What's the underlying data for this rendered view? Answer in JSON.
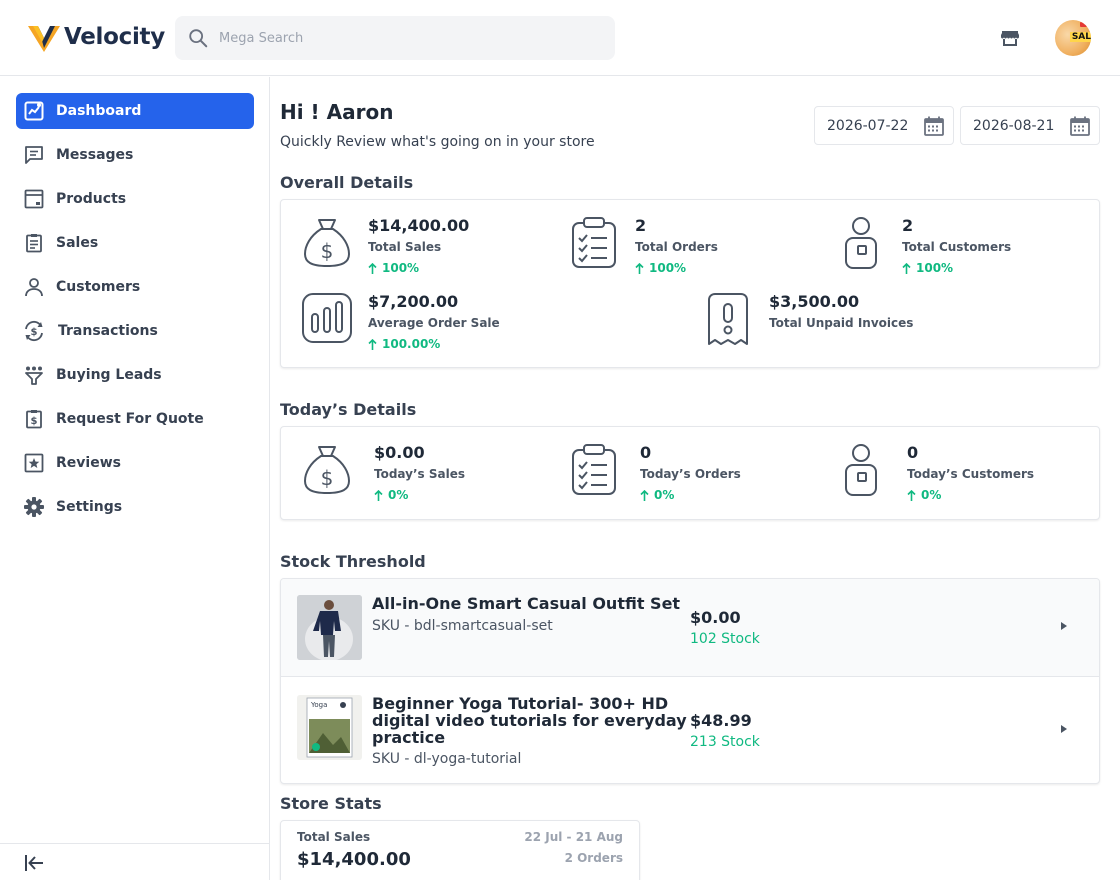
{
  "header": {
    "brand": "Velocity",
    "search_placeholder": "Mega Search",
    "avatar_badge": "SAL"
  },
  "sidebar": {
    "items": [
      {
        "label": "Dashboard",
        "icon": "dashboard-icon",
        "active": true
      },
      {
        "label": "Messages",
        "icon": "message-icon"
      },
      {
        "label": "Products",
        "icon": "product-icon"
      },
      {
        "label": "Sales",
        "icon": "sales-icon"
      },
      {
        "label": "Customers",
        "icon": "customer-icon"
      },
      {
        "label": "Transactions",
        "icon": "transaction-icon"
      },
      {
        "label": "Buying Leads",
        "icon": "funnel-icon"
      },
      {
        "label": "Request For Quote",
        "icon": "quote-icon"
      },
      {
        "label": "Reviews",
        "icon": "review-icon"
      },
      {
        "label": "Settings",
        "icon": "gear-icon"
      }
    ]
  },
  "main": {
    "greeting": "Hi ! Aaron",
    "subtitle": "Quickly Review what's going on in your store",
    "date_from": "2026-07-22",
    "date_to": "2026-08-21",
    "overall": {
      "title": "Overall Details",
      "total_sales": {
        "value": "$14,400.00",
        "label": "Total Sales",
        "trend": "100%"
      },
      "total_orders": {
        "value": "2",
        "label": "Total Orders",
        "trend": "100%"
      },
      "total_customers": {
        "value": "2",
        "label": "Total Customers",
        "trend": "100%"
      },
      "avg_order": {
        "value": "$7,200.00",
        "label": "Average Order Sale",
        "trend": "100.00%"
      },
      "unpaid": {
        "value": "$3,500.00",
        "label": "Total Unpaid Invoices"
      }
    },
    "today": {
      "title": "Today’s Details",
      "sales": {
        "value": "$0.00",
        "label": "Today’s Sales",
        "trend": "0%"
      },
      "orders": {
        "value": "0",
        "label": "Today’s Orders",
        "trend": "0%"
      },
      "customers": {
        "value": "0",
        "label": "Today’s Customers",
        "trend": "0%"
      }
    },
    "stock": {
      "title": "Stock Threshold",
      "items": [
        {
          "name": "All-in-One Smart Casual Outfit Set",
          "sku": "SKU - bdl-smartcasual-set",
          "price": "$0.00",
          "qty": "102 Stock"
        },
        {
          "name": "Beginner Yoga Tutorial- 300+ HD digital video tutorials for everyday practice",
          "sku": "SKU - dl-yoga-tutorial",
          "price": "$48.99",
          "qty": "213 Stock",
          "thumb_text": "Yoga"
        }
      ]
    },
    "store_stats": {
      "title": "Store Stats",
      "label": "Total Sales",
      "value": "$14,400.00",
      "range": "22 Jul - 21 Aug",
      "orders": "2 Orders"
    }
  },
  "colors": {
    "accent": "#2563eb",
    "positive": "#10b981",
    "logo_orange": "#f5a524",
    "logo_navy": "#1f2e4a"
  }
}
